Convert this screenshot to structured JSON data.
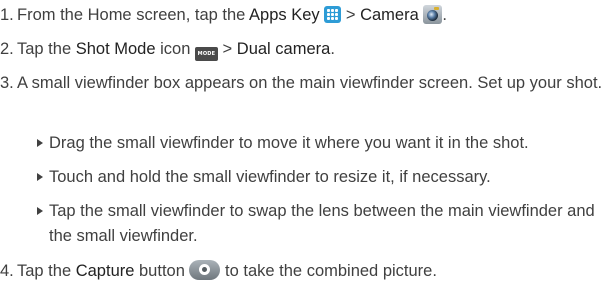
{
  "steps": {
    "s1": {
      "num": "1.",
      "text_a": "From the Home screen, tap the ",
      "bold_a": "Apps Key",
      "text_b": " > ",
      "bold_b": "Camera",
      "apps_icon": "apps-grid-icon",
      "camera_icon": "camera-app-icon"
    },
    "s2": {
      "num": "2.",
      "text_a": "Tap the ",
      "bold_a": "Shot Mode",
      "text_b": " icon ",
      "icon_label": "MODE",
      "text_c": " > ",
      "bold_b": "Dual camera",
      "text_d": "."
    },
    "s3": {
      "num": "3.",
      "text": "A small viewfinder box appears on the main viewfinder screen. Set up your shot.",
      "bullets": [
        "Drag the small viewfinder to move it where you want it in the shot.",
        "Touch and hold the small viewfinder to resize it, if necessary.",
        "Tap the small viewfinder to swap the lens between the main viewfinder and the small viewfinder."
      ]
    },
    "s4": {
      "num": "4.",
      "text_a": "Tap the ",
      "bold_a": "Capture",
      "text_b": " button ",
      "text_c": " to take the combined picture.",
      "capture_icon": "capture-button-icon"
    }
  },
  "colors": {
    "text": "#404040",
    "accent_blue": "#2e9cd6"
  }
}
